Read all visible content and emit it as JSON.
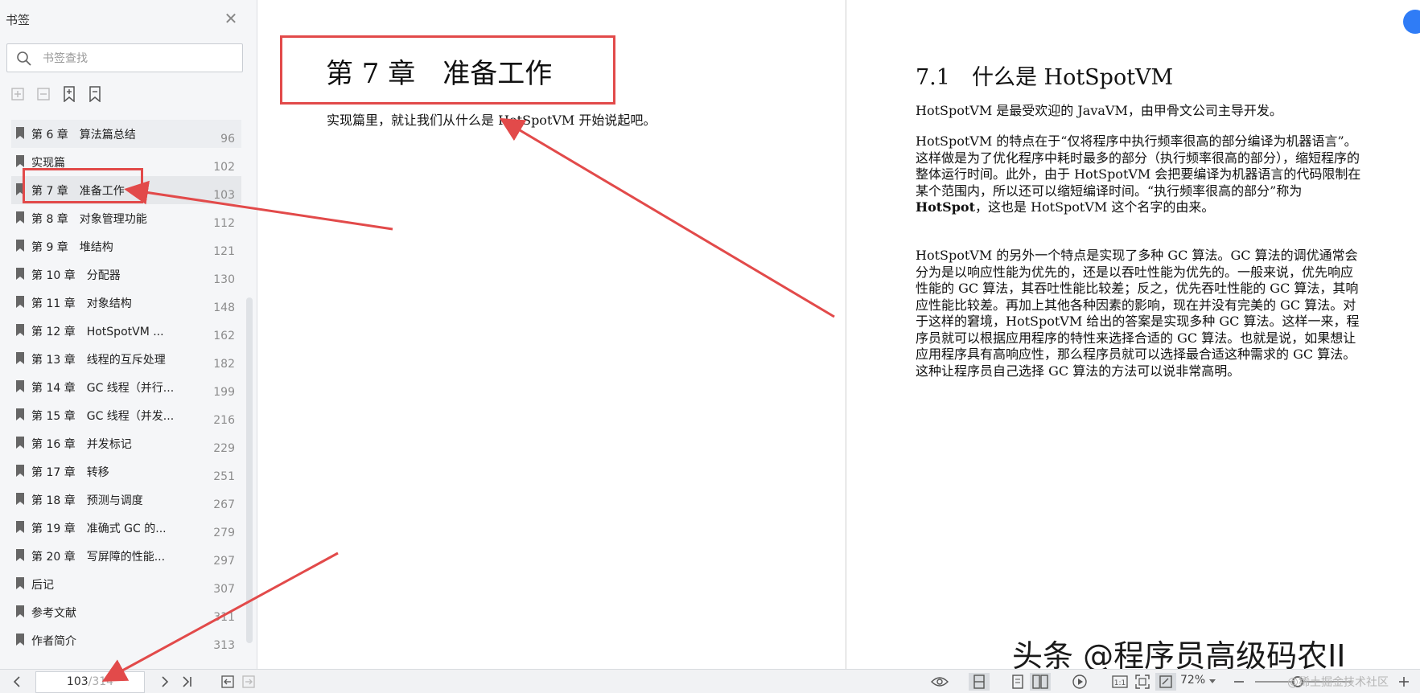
{
  "sidebar": {
    "title": "书签",
    "search_placeholder": "书签查找",
    "items": [
      {
        "label": "第 6 章　算法篇总结",
        "page": "96"
      },
      {
        "label": "实现篇",
        "page": "102"
      },
      {
        "label": "第 7 章　准备工作",
        "page": "103"
      },
      {
        "label": "第 8 章　对象管理功能",
        "page": "112"
      },
      {
        "label": "第 9 章　堆结构",
        "page": "121"
      },
      {
        "label": "第 10 章　分配器",
        "page": "130"
      },
      {
        "label": "第 11 章　对象结构",
        "page": "148"
      },
      {
        "label": "第 12 章　HotSpotVM ...",
        "page": "162"
      },
      {
        "label": "第 13 章　线程的互斥处理",
        "page": "182"
      },
      {
        "label": "第 14 章　GC 线程（并行...",
        "page": "199"
      },
      {
        "label": "第 15 章　GC 线程（并发...",
        "page": "216"
      },
      {
        "label": "第 16 章　并发标记",
        "page": "229"
      },
      {
        "label": "第 17 章　转移",
        "page": "251"
      },
      {
        "label": "第 18 章　预测与调度",
        "page": "267"
      },
      {
        "label": "第 19 章　准确式 GC 的...",
        "page": "279"
      },
      {
        "label": "第 20 章　写屏障的性能...",
        "page": "297"
      },
      {
        "label": "后记",
        "page": "307"
      },
      {
        "label": "参考文献",
        "page": "311"
      },
      {
        "label": "作者简介",
        "page": "313"
      }
    ]
  },
  "left_page": {
    "chapter_title": "第 7 章　准备工作",
    "intro": "实现篇里，就让我们从什么是 HotSpotVM 开始说起吧。"
  },
  "right_page": {
    "section_title": "7.1　什么是 HotSpotVM",
    "p1": "HotSpotVM 是最受欢迎的 JavaVM，由甲骨文公司主导开发。",
    "p2_a": "HotSpotVM 的特点在于“仅将程序中执行频率很高的部分编译为机器语言”。这样做是为了优化程序中耗时最多的部分（执行频率很高的部分），缩短程序的整体运行时间。此外，由于 HotSpotVM 会把要编译为机器语言的代码限制在某个范围内，所以还可以缩短编译时间。“执行频率很高的部分”称为 ",
    "p2_bold": "HotSpot",
    "p2_b": "，这也是 HotSpotVM 这个名字的由来。",
    "p3": "HotSpotVM 的另外一个特点是实现了多种 GC 算法。GC 算法的调优通常会分为是以响应性能为优先的，还是以吞吐性能为优先的。一般来说，优先响应性能的 GC 算法，其吞吐性能比较差；反之，优先吞吐性能的 GC 算法，其响应性能比较差。再加上其他各种因素的影响，现在并没有完美的 GC 算法。对于这样的窘境，HotSpotVM 给出的答案是实现多种 GC 算法。这样一来，程序员就可以根据应用程序的特性来选择合适的 GC 算法。也就是说，如果想让应用程序具有高响应性，那么程序员就可以选择最合适这种需求的 GC 算法。这种让程序员自己选择 GC 算法的方法可以说非常高明。"
  },
  "watermark": "头条 @程序员高级码农II",
  "toolbar": {
    "current_page": "103",
    "total_pages": "/314",
    "zoom": "72%",
    "site_watermark": "@稀土掘金技术社区"
  },
  "colors": {
    "annotation_red": "#e24a4a",
    "sidebar_bg": "#f5f6f8",
    "badge_blue": "#2f7cf6"
  }
}
